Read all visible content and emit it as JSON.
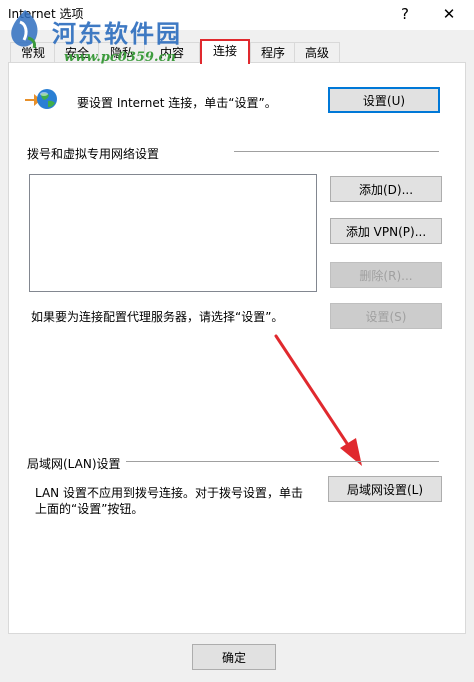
{
  "window": {
    "title": "Internet 选项",
    "help_label": "?",
    "close_label": "✕"
  },
  "watermark": {
    "name": "河东软件园",
    "url": "www.pc0359.cn"
  },
  "tabs": [
    {
      "label": "常规"
    },
    {
      "label": "安全"
    },
    {
      "label": "隐私"
    },
    {
      "label": "内容"
    },
    {
      "label": "连接",
      "active": true
    },
    {
      "label": "程序"
    },
    {
      "label": "高级"
    }
  ],
  "setup": {
    "text": "要设置 Internet 连接，单击“设置”。",
    "button": "设置(U)"
  },
  "dialup": {
    "heading": "拨号和虚拟专用网络设置",
    "add_button": "添加(D)...",
    "add_vpn_button": "添加 VPN(P)...",
    "remove_button": "删除(R)...",
    "settings_button": "设置(S)",
    "proxy_text": "如果要为连接配置代理服务器，请选择“设置”。"
  },
  "lan": {
    "heading": "局域网(LAN)设置",
    "text_line1": "LAN 设置不应用到拨号连接。对于拨号设置，单击",
    "text_line2": "上面的“设置”按钮。",
    "button": "局域网设置(L)"
  },
  "footer": {
    "ok_button": "确定"
  },
  "colors": {
    "highlight": "#e0292e",
    "accent": "#0078d7",
    "arrow": "#e0292e"
  }
}
